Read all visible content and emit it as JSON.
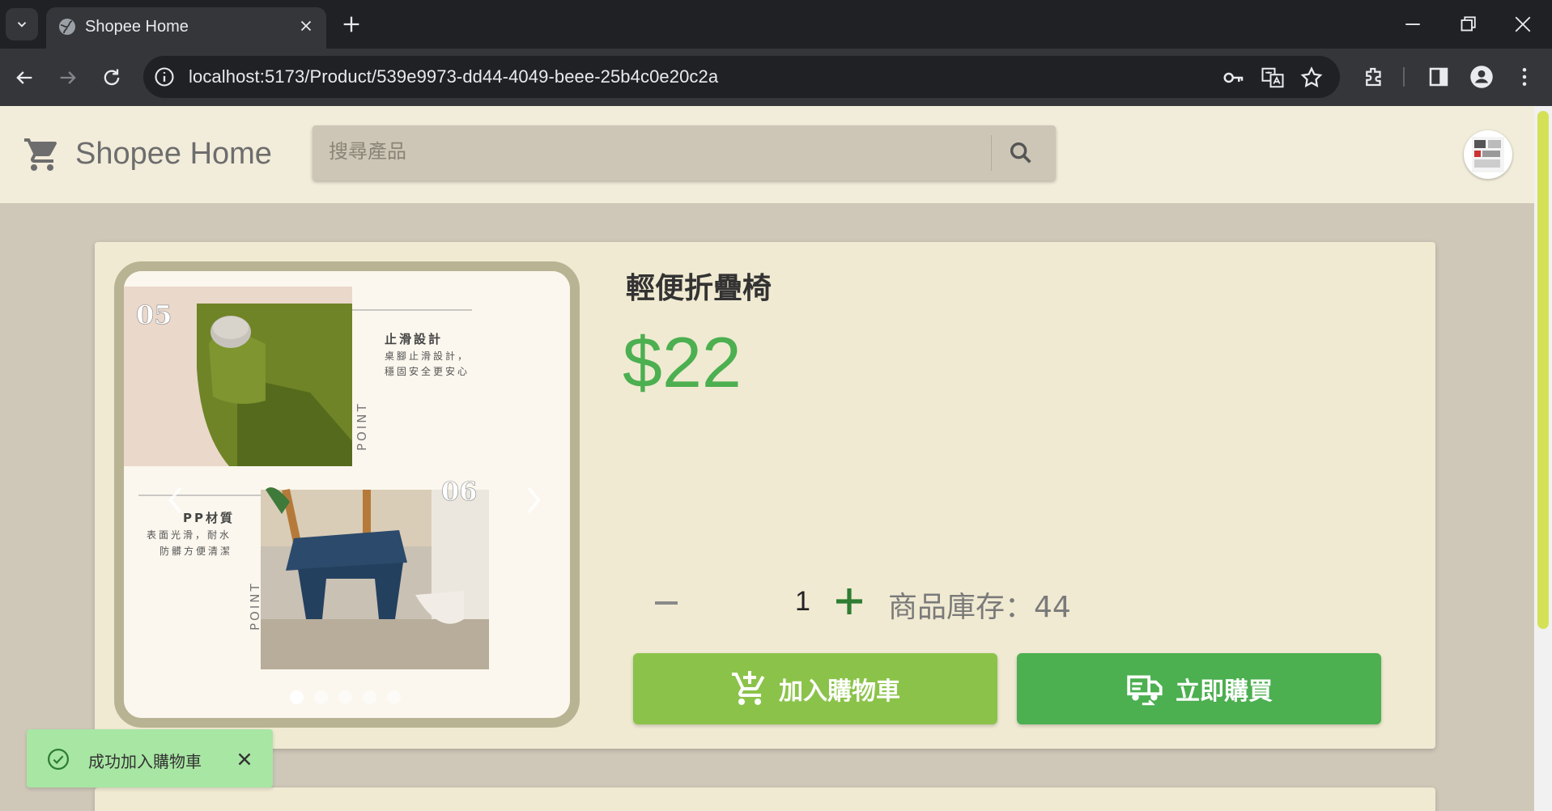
{
  "browser": {
    "tab_title": "Shopee Home",
    "url": "localhost:5173/Product/539e9973-dd44-4049-beee-25b4c0e20c2a"
  },
  "appbar": {
    "brand": "Shopee Home",
    "search_placeholder": "搜尋產品"
  },
  "product": {
    "name": "輕便折疊椅",
    "price": "$22",
    "quantity": "1",
    "stock_label": "商品庫存：44",
    "add_to_cart_label": "加入購物車",
    "buy_now_label": "立即購買"
  },
  "carousel": {
    "slide_count": 5,
    "active_index": 0,
    "image": {
      "num_top": "05",
      "num_bottom": "06",
      "feature1_title": "止滑設計",
      "feature1_line1": "桌腳止滑設計，",
      "feature1_line2": "穩固安全更安心",
      "feature2_title": "PP材質",
      "feature2_line1": "表面光滑，耐水",
      "feature2_line2": "防髒方便清潔",
      "point_label": "POINT"
    }
  },
  "toast": {
    "message": "成功加入購物車"
  },
  "colors": {
    "accent_green": "#4caf50",
    "light_green": "#8bc34a",
    "page_bg": "#cfc7b8",
    "card_bg": "#f0ead2",
    "toast_bg": "#a8e6a3"
  }
}
